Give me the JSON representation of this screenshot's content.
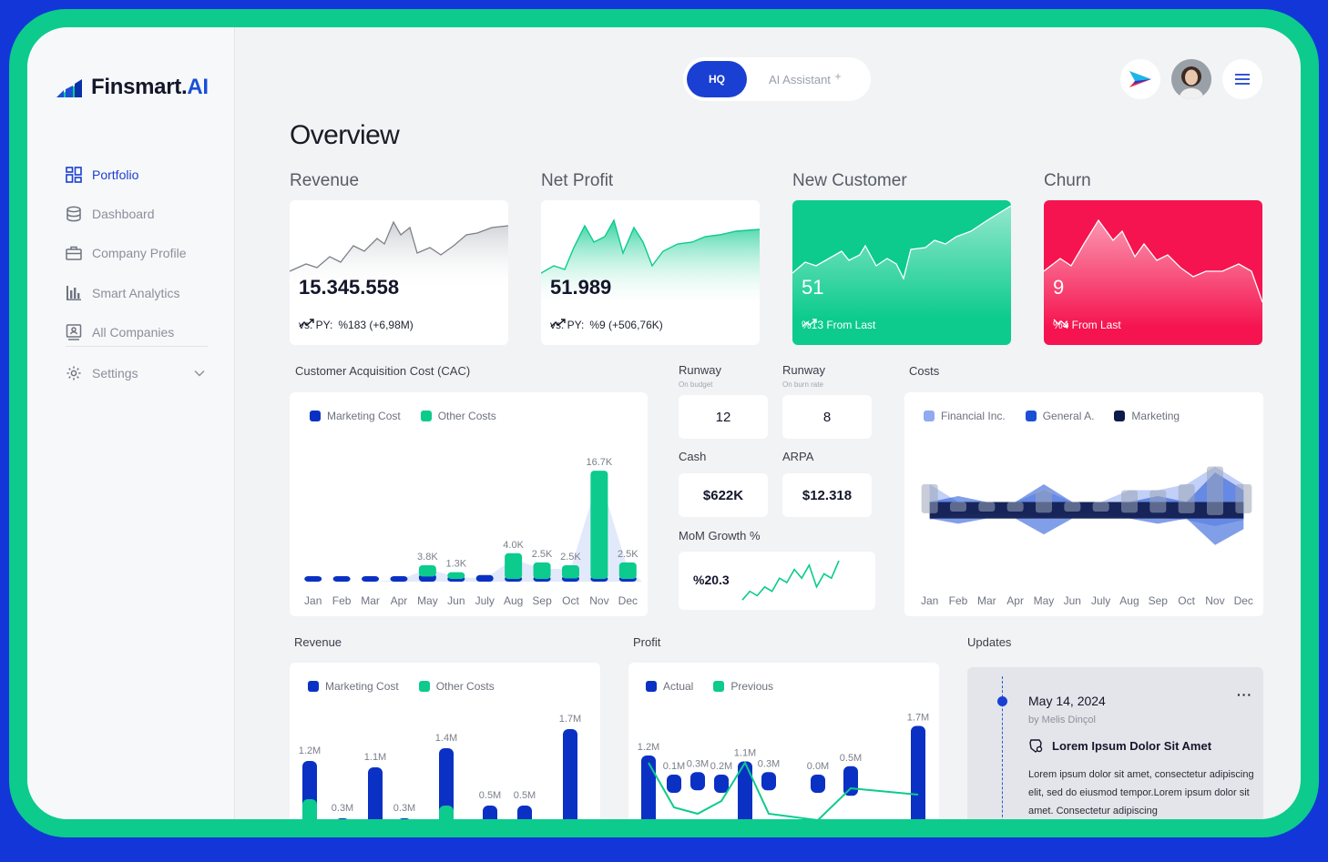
{
  "brand": {
    "name": "Finsmart.",
    "accent": "AI"
  },
  "sidebar": {
    "items": [
      {
        "label": "Portfolio",
        "icon": "grid-icon",
        "active": true
      },
      {
        "label": "Dashboard",
        "icon": "database-icon"
      },
      {
        "label": "Company Profile",
        "icon": "briefcase-icon"
      },
      {
        "label": "Smart Analytics",
        "icon": "bar-chart-icon"
      },
      {
        "label": "All Companies",
        "icon": "id-card-icon"
      },
      {
        "label": "Settings",
        "icon": "gear-icon",
        "has_submenu": true
      }
    ]
  },
  "topbar": {
    "toggle_active": "HQ",
    "toggle_other": "AI Assistant"
  },
  "page_title": "Overview",
  "kpis": [
    {
      "label": "Revenue",
      "value": "15.345.558",
      "prefix": "vs. PY:",
      "change": "%183 (+6,98M)",
      "trend": "up"
    },
    {
      "label": "Net Profit",
      "value": "51.989",
      "prefix": "vs. PY:",
      "change": "%9 (+506,76K)",
      "trend": "up"
    },
    {
      "label": "New Customer",
      "value": "51",
      "change": "%13 From Last",
      "trend": "up"
    },
    {
      "label": "Churn",
      "value": "9",
      "change": "%4 From Last",
      "trend": "down"
    }
  ],
  "colors": {
    "blue": "#0b31c4",
    "green": "#0ccb8d",
    "red": "#f5144f",
    "background": "#1336d8"
  },
  "cac": {
    "title": "Customer Acquisition Cost (CAC)",
    "legend": [
      "Marketing Cost",
      "Other Costs"
    ],
    "months": [
      "Jan",
      "Feb",
      "Mar",
      "Apr",
      "May",
      "Jun",
      "July",
      "Aug",
      "Sep",
      "Oct",
      "Nov",
      "Dec"
    ]
  },
  "metrics": {
    "runway_budget": {
      "label": "Runway",
      "sub": "On budget",
      "value": "12"
    },
    "runway_burn": {
      "label": "Runway",
      "sub": "On burn rate",
      "value": "8"
    },
    "cash": {
      "label": "Cash",
      "value": "$622K"
    },
    "arpa": {
      "label": "ARPA",
      "value": "$12.318"
    },
    "mom": {
      "label": "MoM Growth %",
      "value": "%20.3"
    }
  },
  "costs": {
    "title": "Costs",
    "legend": [
      "Financial Inc.",
      "General A.",
      "Marketing"
    ],
    "months": [
      "Jan",
      "Feb",
      "Mar",
      "Apr",
      "May",
      "Jun",
      "July",
      "Aug",
      "Sep",
      "Oct",
      "Nov",
      "Dec"
    ]
  },
  "revenue_section": {
    "title": "Revenue",
    "legend": [
      "Marketing Cost",
      "Other Costs"
    ]
  },
  "profit_section": {
    "title": "Profit",
    "legend": [
      "Actual",
      "Previous"
    ]
  },
  "updates": {
    "title": "Updates",
    "date": "May 14, 2024",
    "author": "by Melis Dinçol",
    "headline": "Lorem Ipsum Dolor Sit Amet",
    "body": "Lorem ipsum dolor sit amet, consectetur adipiscing elit, sed do eiusmod tempor.Lorem ipsum dolor sit amet. Consectetur adipiscing",
    "more": "···"
  },
  "chart_data": [
    {
      "type": "bar",
      "title": "Customer Acquisition Cost (CAC)",
      "categories": [
        "Jan",
        "Feb",
        "Mar",
        "Apr",
        "May",
        "Jun",
        "July",
        "Aug",
        "Sep",
        "Oct",
        "Nov",
        "Dec"
      ],
      "series": [
        {
          "name": "Marketing Cost",
          "values": [
            0.3,
            0.2,
            0.6,
            0.8,
            1.2,
            0.7,
            1.0,
            0.5,
            0.4,
            0.9,
            0.6,
            0.4
          ]
        },
        {
          "name": "Other Costs",
          "values": [
            0,
            0,
            0,
            0,
            1.3,
            0.6,
            0,
            3.5,
            2.1,
            1.6,
            16.1,
            2.1
          ]
        }
      ],
      "labels": [
        "",
        "",
        "",
        "",
        "3.8K",
        "1.3K",
        "",
        "4.0K",
        "2.5K",
        "2.5K",
        "16.7K",
        "2.5K"
      ],
      "stacked": true
    },
    {
      "type": "line",
      "title": "MoM Growth %",
      "values": [
        1,
        3,
        2,
        4,
        3,
        6,
        5,
        8,
        6,
        9,
        4,
        7,
        6,
        10
      ]
    },
    {
      "type": "bar",
      "title": "Costs",
      "categories": [
        "Jan",
        "Feb",
        "Mar",
        "Apr",
        "May",
        "Jun",
        "July",
        "Aug",
        "Sep",
        "Oct",
        "Nov",
        "Dec"
      ],
      "series": [
        {
          "name": "Financial Inc.",
          "values": [
            4,
            1,
            1,
            1,
            3,
            1,
            1,
            3,
            3,
            4,
            7,
            4
          ]
        },
        {
          "name": "General A.",
          "values": [
            1,
            2,
            1,
            1,
            4,
            1,
            1,
            1,
            2,
            1,
            6,
            3
          ]
        },
        {
          "name": "Marketing",
          "values": [
            1,
            1,
            1,
            1,
            1,
            1,
            1,
            1,
            1,
            1,
            1,
            1
          ]
        }
      ]
    },
    {
      "type": "bar",
      "title": "Revenue",
      "series": [
        {
          "name": "Marketing Cost",
          "values": [
            1.2,
            0.3,
            1.1,
            0.3,
            1.4,
            0.5,
            0.5,
            1.7
          ]
        },
        {
          "name": "Other Costs",
          "values": [
            0.6,
            0,
            0,
            0,
            0.5,
            0,
            0,
            0
          ]
        }
      ],
      "labels": [
        "1.2M",
        "0.3M",
        "1.1M",
        "0.3M",
        "1.4M",
        "0.5M",
        "0.5M",
        "1.7M"
      ]
    },
    {
      "type": "bar",
      "title": "Profit",
      "series": [
        {
          "name": "Actual",
          "values": [
            1.2,
            0.1,
            0.3,
            0.2,
            1.1,
            0.3,
            0.0,
            0.5,
            1.7
          ]
        },
        {
          "name": "Previous",
          "values": [
            1.0,
            0.3,
            0.2,
            0.4,
            1.0,
            0.2,
            0.1,
            0.6,
            0.5
          ]
        }
      ],
      "labels": [
        "1.2M",
        "0.1M",
        "0.3M",
        "0.2M",
        "1.1M",
        "0.3M",
        "0.0M",
        "0.5M",
        "1.7M"
      ]
    }
  ]
}
